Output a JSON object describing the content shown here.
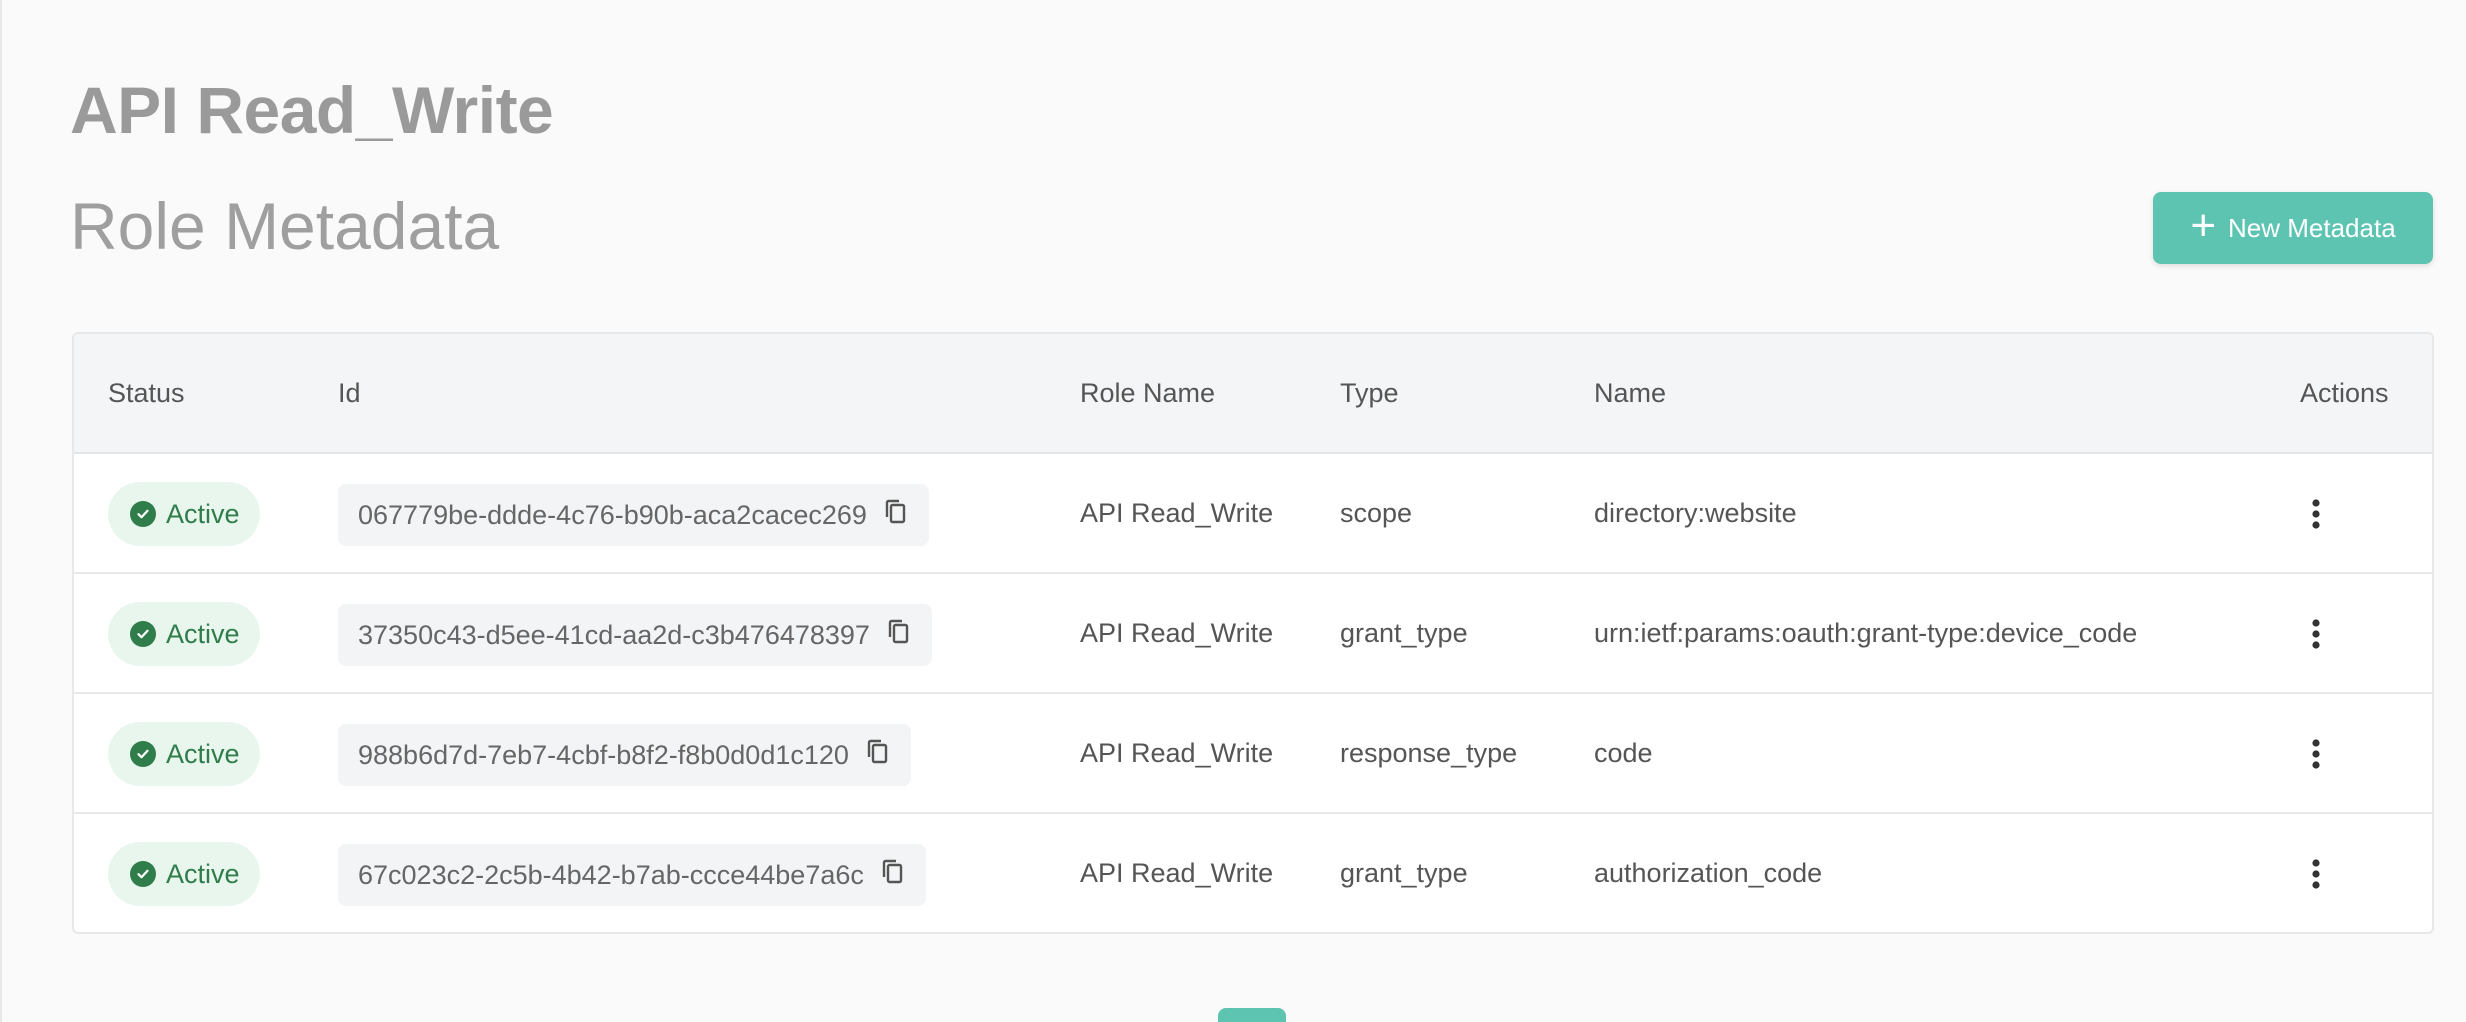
{
  "header": {
    "title": "API Read_Write",
    "subtitle": "Role Metadata"
  },
  "toolbar": {
    "new_label": "New Metadata"
  },
  "table": {
    "columns": [
      "Status",
      "Id",
      "Role Name",
      "Type",
      "Name",
      "Actions"
    ],
    "rows": [
      {
        "status": "Active",
        "id": "067779be-ddde-4c76-b90b-aca2cacec269",
        "role": "API Read_Write",
        "type": "scope",
        "name": "directory:website"
      },
      {
        "status": "Active",
        "id": "37350c43-d5ee-41cd-aa2d-c3b476478397",
        "role": "API Read_Write",
        "type": "grant_type",
        "name": "urn:ietf:params:oauth:grant-type:device_code"
      },
      {
        "status": "Active",
        "id": "988b6d7d-7eb7-4cbf-b8f2-f8b0d0d1c120",
        "role": "API Read_Write",
        "type": "response_type",
        "name": "code"
      },
      {
        "status": "Active",
        "id": "67c023c2-2c5b-4b42-b7ab-ccce44be7a6c",
        "role": "API Read_Write",
        "type": "grant_type",
        "name": "authorization_code"
      }
    ]
  },
  "icons": {
    "status": "check-circle-icon",
    "copy": "copy-icon",
    "actions": "more-vertical-icon",
    "add": "plus-icon"
  },
  "colors": {
    "accent": "#5cc4b0",
    "active_bg": "#e9f6ee",
    "active_fg": "#2f7d4a"
  }
}
